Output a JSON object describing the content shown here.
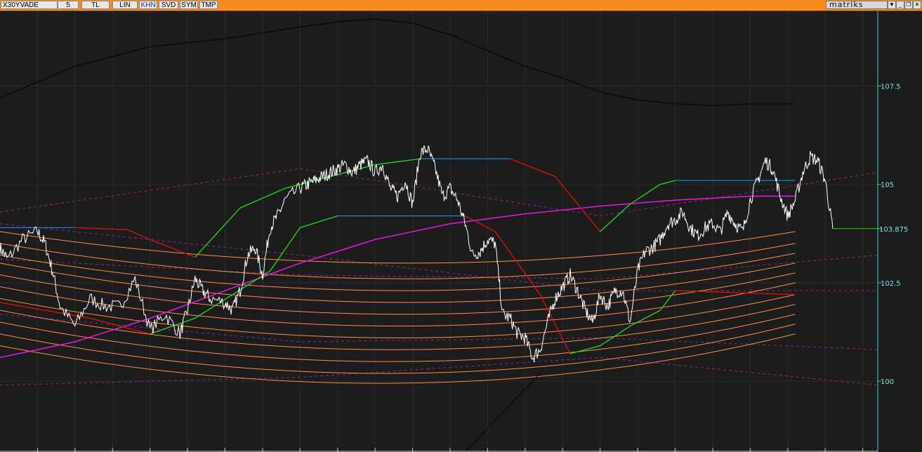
{
  "toolbar": {
    "symbol": "X30YVADE",
    "period": "5",
    "currency": "TL",
    "scale": "LIN",
    "buttons": [
      "KHN",
      "SVD",
      "SYM",
      "TMP"
    ],
    "active_button": "KHN",
    "brand": "matriks",
    "window_buttons": [
      "▼",
      "_",
      "❐",
      "✕"
    ]
  },
  "colors": {
    "background": "#1c1c1c",
    "toolbar": "#f68a1f",
    "price": "#ffffff",
    "grid": "#2a2a2a",
    "axis": "#3fc6c6",
    "last_price_line": "#22cc22",
    "black_curve": "#050505",
    "magenta_curve": "#e619e6",
    "green_red_stop": [
      "#22dd22",
      "#dd1111",
      "#1e7fd0"
    ],
    "orange_channel": "#ff8c4a",
    "purple_dashed": "#8a2a8a"
  },
  "chart_data": {
    "type": "line",
    "title": "",
    "xlabel": "",
    "ylabel": "",
    "y_axis_position": "right",
    "ylim": [
      98.2,
      109.4
    ],
    "yticks": [
      100,
      102.5,
      105,
      107.5
    ],
    "last_price": 103.875,
    "grid": true,
    "series": [
      {
        "role": "price",
        "x": [
          0,
          1,
          3,
          5,
          6,
          7,
          8,
          10,
          12,
          14,
          16,
          18,
          20,
          22,
          24,
          25,
          26,
          27,
          28,
          30,
          31,
          32,
          33,
          34,
          35,
          36,
          37,
          38,
          40,
          41,
          42,
          43,
          44,
          45,
          46,
          47,
          48,
          49,
          50,
          51,
          52,
          53,
          54,
          55,
          56,
          57,
          58,
          59,
          60,
          61,
          62,
          63,
          64,
          65,
          66,
          67,
          68,
          69,
          70,
          71,
          72,
          73,
          74,
          75,
          76,
          77,
          78,
          79,
          80,
          81,
          82,
          83,
          84,
          85,
          86,
          87,
          88,
          89,
          90,
          91,
          92,
          93,
          94,
          95,
          96,
          97,
          98,
          99,
          100,
          101,
          102,
          103,
          104,
          105,
          106,
          107,
          108,
          109,
          110,
          111
        ],
        "y": [
          103.4,
          103.1,
          103.6,
          103.8,
          103.5,
          102.8,
          101.9,
          101.4,
          102.1,
          101.9,
          101.9,
          102.6,
          101.3,
          101.7,
          101.2,
          101.8,
          102.6,
          102.3,
          102.1,
          102.0,
          101.8,
          102.3,
          103.2,
          103.4,
          102.7,
          103.9,
          104.2,
          104.6,
          104.9,
          105.0,
          105.1,
          105.2,
          105.3,
          105.4,
          105.5,
          105.3,
          105.5,
          105.6,
          105.3,
          105.5,
          104.9,
          104.7,
          105.1,
          104.5,
          105.8,
          105.9,
          105.4,
          104.7,
          104.9,
          104.6,
          104.0,
          103.2,
          103.3,
          103.6,
          103.5,
          101.7,
          101.6,
          101.2,
          101.1,
          100.6,
          100.8,
          101.5,
          102.1,
          102.4,
          102.7,
          102.3,
          101.8,
          101.5,
          102.2,
          101.9,
          102.3,
          102.3,
          101.5,
          102.8,
          103.3,
          103.4,
          103.6,
          104.0,
          104.1,
          104.3,
          103.9,
          103.7,
          103.9,
          104.0,
          103.8,
          104.3,
          104.0,
          103.8,
          104.6,
          105.1,
          105.6,
          105.4,
          104.7,
          104.2,
          104.6,
          105.3,
          105.7,
          105.6,
          105.1,
          103.875
        ]
      },
      {
        "role": "black_curve",
        "x": [
          0,
          10,
          20,
          30,
          40,
          46,
          50,
          55,
          60,
          65,
          70,
          75,
          80,
          85,
          90,
          95,
          100,
          106
        ],
        "y": [
          107.2,
          108.0,
          108.5,
          108.7,
          109.0,
          109.15,
          109.2,
          109.1,
          108.8,
          108.4,
          108.0,
          107.7,
          107.35,
          107.15,
          107.05,
          107.0,
          107.05,
          107.05
        ]
      },
      {
        "role": "magenta_curve",
        "x": [
          0,
          10,
          20,
          30,
          40,
          50,
          60,
          70,
          80,
          90,
          100,
          106
        ],
        "y": [
          100.6,
          101.0,
          101.6,
          102.3,
          103.0,
          103.6,
          104.0,
          104.25,
          104.45,
          104.6,
          104.7,
          104.7
        ]
      },
      {
        "role": "stop_line",
        "x": [
          0,
          10,
          17,
          20,
          26,
          32,
          38,
          44,
          50,
          56,
          62,
          68,
          74,
          80,
          84,
          88,
          90,
          94,
          100,
          106
        ],
        "y": [
          103.9,
          103.9,
          103.85,
          103.6,
          103.15,
          104.4,
          104.9,
          105.2,
          105.5,
          105.65,
          105.65,
          105.65,
          105.2,
          103.8,
          104.5,
          105.0,
          105.1,
          105.1,
          105.1,
          105.1
        ]
      },
      {
        "role": "lower_stop_line",
        "x": [
          0,
          12,
          20,
          26,
          36,
          40,
          45,
          48,
          58,
          62,
          66,
          72,
          76,
          80,
          84,
          88,
          90,
          106
        ],
        "y": [
          102.0,
          101.6,
          101.2,
          101.6,
          102.8,
          103.9,
          104.2,
          104.2,
          104.2,
          104.2,
          103.8,
          102.2,
          100.7,
          100.9,
          101.4,
          101.8,
          102.3,
          102.2
        ]
      }
    ],
    "channel_lines": [
      {
        "name": "channel",
        "left": 103.8,
        "bottom": 103.0,
        "right": 103.8
      },
      {
        "name": "channel",
        "left": 103.5,
        "bottom": 102.6,
        "right": 103.5
      },
      {
        "name": "channel",
        "left": 103.2,
        "bottom": 102.3,
        "right": 103.25
      },
      {
        "name": "channel",
        "left": 103.0,
        "bottom": 102.0,
        "right": 103.0
      },
      {
        "name": "channel",
        "left": 102.7,
        "bottom": 101.7,
        "right": 102.75
      },
      {
        "name": "channel",
        "left": 102.4,
        "bottom": 101.4,
        "right": 102.5
      },
      {
        "name": "channel",
        "left": 102.1,
        "bottom": 101.1,
        "right": 102.2
      },
      {
        "name": "channel",
        "left": 101.8,
        "bottom": 100.8,
        "right": 101.95
      },
      {
        "name": "channel",
        "left": 101.5,
        "bottom": 100.5,
        "right": 101.7
      },
      {
        "name": "channel",
        "left": 101.2,
        "bottom": 100.2,
        "right": 101.45
      },
      {
        "name": "channel",
        "left": 100.9,
        "bottom": 99.95,
        "right": 101.2
      }
    ],
    "dashed_lines": [
      {
        "x": [
          0,
          40,
          80,
          117
        ],
        "y": [
          103.1,
          102.7,
          102.6,
          103.2
        ]
      },
      {
        "x": [
          0,
          40,
          80,
          117
        ],
        "y": [
          104.3,
          105.4,
          104.2,
          105.3
        ]
      },
      {
        "x": [
          0,
          40,
          80,
          117
        ],
        "y": [
          101.7,
          101.0,
          101.1,
          100.8
        ]
      },
      {
        "x": [
          0,
          40,
          80,
          117
        ],
        "y": [
          104.0,
          103.2,
          102.3,
          102.3
        ]
      },
      {
        "x": [
          0,
          40,
          80,
          117
        ],
        "y": [
          99.9,
          100.1,
          100.6,
          99.9
        ]
      }
    ]
  }
}
